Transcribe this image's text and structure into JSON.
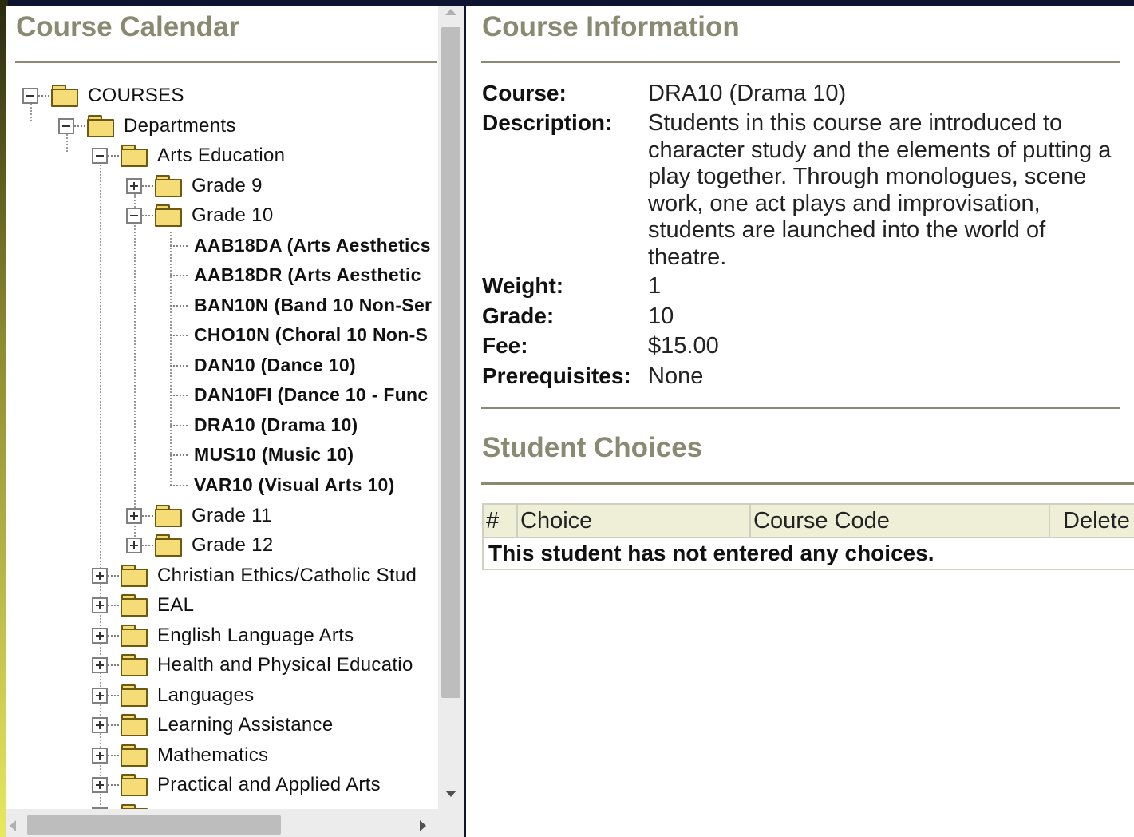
{
  "calendar": {
    "title": "Course Calendar",
    "tree": {
      "root": "COURSES",
      "departments": "Departments",
      "arts": "Arts Education",
      "grade9": "Grade 9",
      "grade10": "Grade 10",
      "courses": [
        "AAB18DA (Arts Aesthetics",
        "AAB18DR (Arts Aesthetic",
        "BAN10N (Band 10 Non-Ser",
        "CHO10N (Choral 10 Non-S",
        "DAN10 (Dance 10)",
        "DAN10FI (Dance 10 - Func",
        "DRA10 (Drama 10)",
        "MUS10 (Music 10)",
        "VAR10 (Visual Arts 10)"
      ],
      "grade11": "Grade 11",
      "grade12": "Grade 12",
      "departments_list": [
        "Christian Ethics/Catholic Stud",
        "EAL",
        "English Language Arts",
        "Health and Physical Educatio",
        "Languages",
        "Learning Assistance",
        "Mathematics",
        "Practical and Applied Arts"
      ]
    }
  },
  "info": {
    "title": "Course Information",
    "course_label": "Course:",
    "course_value": "DRA10 (Drama 10)",
    "description_label": "Description:",
    "description_value": "Students in this course are introduced to character study and the elements of putting a play together. Through monologues, scene work, one act plays and improvisation, students are launched into the world of theatre.",
    "weight_label": "Weight:",
    "weight_value": "1",
    "grade_label": "Grade:",
    "grade_value": "10",
    "fee_label": "Fee:",
    "fee_value": "$15.00",
    "prereq_label": "Prerequisites:",
    "prereq_value": "None"
  },
  "choices": {
    "title": "Student Choices",
    "headers": [
      "#",
      "Choice",
      "Course Code",
      "Delete"
    ],
    "empty_message": "This student has not entered any choices."
  },
  "colors": {
    "heading": "#8a8a72",
    "rule": "#8a8a72",
    "table_header_bg": "#efefd8",
    "folder": "#f6dc77"
  },
  "icons": [
    "folder-icon",
    "expand-icon",
    "collapse-icon"
  ]
}
